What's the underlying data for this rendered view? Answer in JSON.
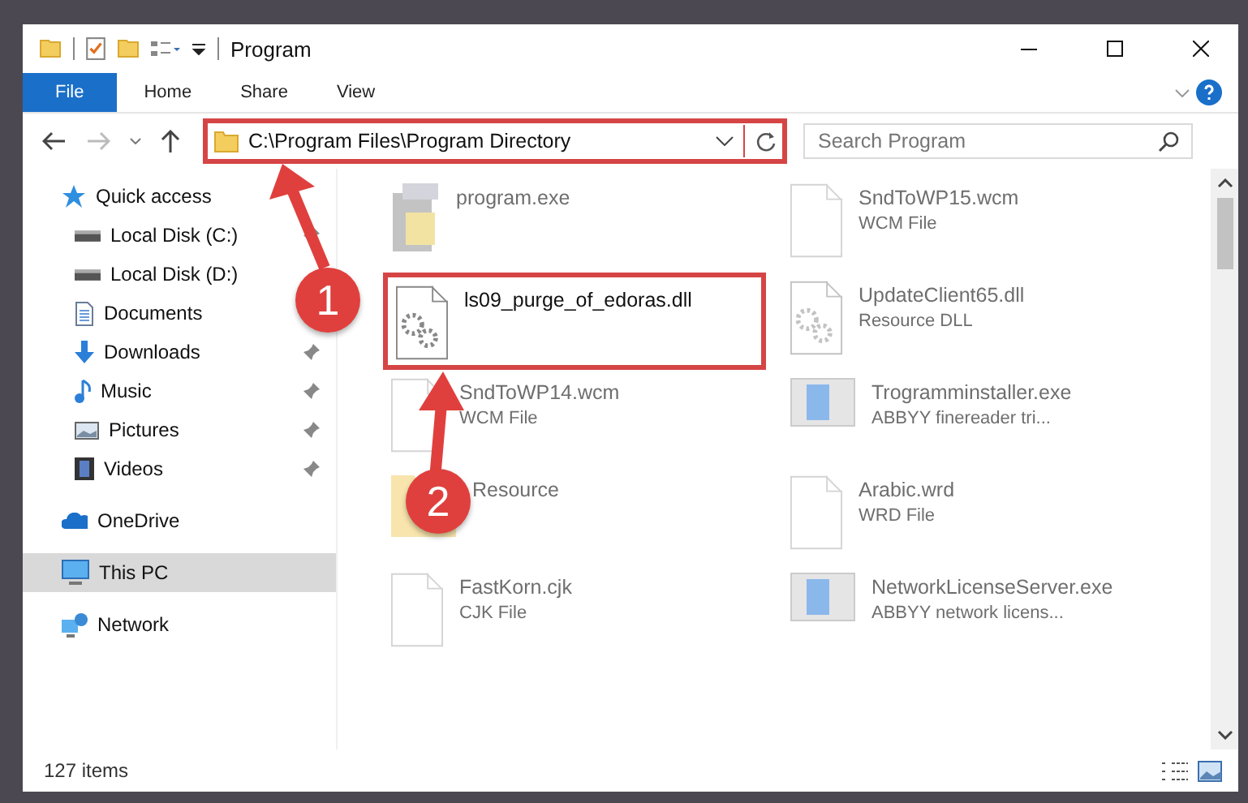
{
  "window": {
    "title": "Program"
  },
  "ribbon": {
    "tabs": [
      {
        "label": "File",
        "selected": true
      },
      {
        "label": "Home",
        "selected": false
      },
      {
        "label": "Share",
        "selected": false
      },
      {
        "label": "View",
        "selected": false
      }
    ]
  },
  "address_bar": {
    "path": "C:\\Program Files\\Program Directory",
    "highlighted": true
  },
  "search": {
    "placeholder": "Search Program"
  },
  "sidebar": {
    "items": [
      {
        "label": "Quick access",
        "kind": "star",
        "pinned": false,
        "selected": false,
        "children": [
          {
            "label": "Local Disk (C:)",
            "kind": "disk",
            "pinned": true,
            "selected": false
          },
          {
            "label": "Local Disk (D:)",
            "kind": "disk",
            "pinned": false,
            "selected": false
          },
          {
            "label": "Documents",
            "kind": "doc",
            "pinned": false,
            "selected": false
          },
          {
            "label": "Downloads",
            "kind": "download",
            "pinned": true,
            "selected": false
          },
          {
            "label": "Music",
            "kind": "music",
            "pinned": true,
            "selected": false
          },
          {
            "label": "Pictures",
            "kind": "picture",
            "pinned": true,
            "selected": false
          },
          {
            "label": "Videos",
            "kind": "video",
            "pinned": true,
            "selected": false
          }
        ]
      },
      {
        "label": "OneDrive",
        "kind": "cloud",
        "pinned": false,
        "selected": false
      },
      {
        "label": "This PC",
        "kind": "pc",
        "pinned": false,
        "selected": true
      },
      {
        "label": "Network",
        "kind": "network",
        "pinned": false,
        "selected": false
      }
    ]
  },
  "files": [
    {
      "name": "program.exe",
      "kind": "installer",
      "faded": true,
      "highlighted": false
    },
    {
      "name": "SndToWP15.wcm",
      "type": "WCM File",
      "kind": "blank",
      "faded": true,
      "highlighted": false
    },
    {
      "name": "ls09_purge_of_edoras.dll",
      "kind": "gears",
      "faded": false,
      "highlighted": true
    },
    {
      "name": "UpdateClient65.dll",
      "type": "Resource DLL",
      "kind": "gears",
      "faded": true,
      "highlighted": false
    },
    {
      "name": "SndToWP14.wcm",
      "type": "WCM File",
      "kind": "blank",
      "faded": true,
      "highlighted": false
    },
    {
      "name": "Trogramminstaller.exe",
      "type": "ABBYY finereader tri...",
      "kind": "app",
      "faded": true,
      "highlighted": false
    },
    {
      "name": "Resource",
      "kind": "folder",
      "faded": true,
      "highlighted": false
    },
    {
      "name": "Arabic.wrd",
      "type": "WRD File",
      "kind": "blank",
      "faded": true,
      "highlighted": false
    },
    {
      "name": "FastKorn.cjk",
      "type": "CJK File",
      "kind": "blank",
      "faded": true,
      "highlighted": false
    },
    {
      "name": "NetworkLicenseServer.exe",
      "type": "ABBYY network licens...",
      "kind": "app",
      "faded": true,
      "highlighted": false
    }
  ],
  "annotations": [
    {
      "number": "1"
    },
    {
      "number": "2"
    }
  ],
  "status_bar": {
    "count": "127 items"
  }
}
